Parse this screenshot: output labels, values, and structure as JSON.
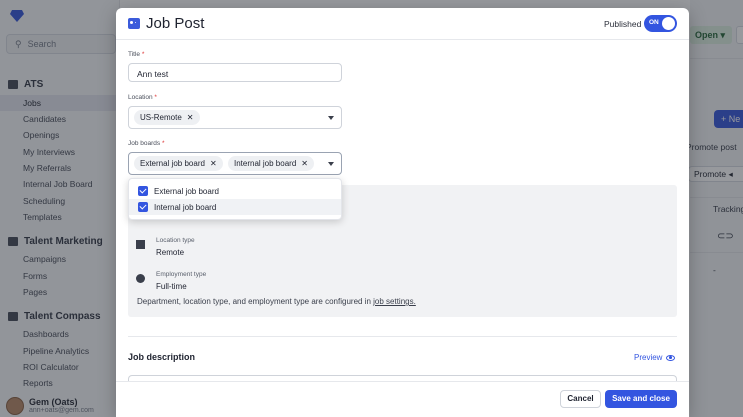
{
  "sidebar": {
    "search_placeholder": "Search",
    "sections": [
      {
        "label": "ATS",
        "items": [
          "Jobs",
          "Candidates",
          "Openings",
          "My Interviews",
          "My Referrals",
          "Internal Job Board",
          "Scheduling",
          "Templates"
        ]
      },
      {
        "label": "Talent Marketing",
        "items": [
          "Campaigns",
          "Forms",
          "Pages"
        ]
      },
      {
        "label": "Talent Compass",
        "items": [
          "Dashboards",
          "Pipeline Analytics",
          "ROI Calculator",
          "Reports"
        ]
      }
    ],
    "active_item": "Jobs",
    "user": {
      "name": "Gem (Oats)",
      "email": "ann+oats@gem.com"
    }
  },
  "background": {
    "status_button": "Open",
    "new_button": "+ Ne",
    "promote_post": "Promote post",
    "promote": "Promote",
    "tracking": "Tracking",
    "dash": "-"
  },
  "modal": {
    "title": "Job Post",
    "published_label": "Published",
    "toggle_state": "ON",
    "title_field": {
      "label": "Title",
      "value": "Ann test"
    },
    "location_field": {
      "label": "Location",
      "chips": [
        "US-Remote"
      ]
    },
    "job_boards_field": {
      "label": "Job boards",
      "chips": [
        "External job board",
        "Internal job board"
      ]
    },
    "dropdown_options": [
      {
        "label": "External job board",
        "checked": true
      },
      {
        "label": "Internal job board",
        "checked": true
      }
    ],
    "info": {
      "location_type": {
        "key": "Location type",
        "value": "Remote"
      },
      "employment_type": {
        "key": "Employment type",
        "value": "Full-time"
      },
      "note_prefix": "Department, location type, and employment type are configured in ",
      "note_link": "job settings."
    },
    "job_description_title": "Job description",
    "preview_label": "Preview",
    "footer": {
      "cancel": "Cancel",
      "save": "Save and close"
    }
  },
  "colors": {
    "accent": "#3355e0",
    "overlay": "rgba(24,28,38,0.45)"
  }
}
